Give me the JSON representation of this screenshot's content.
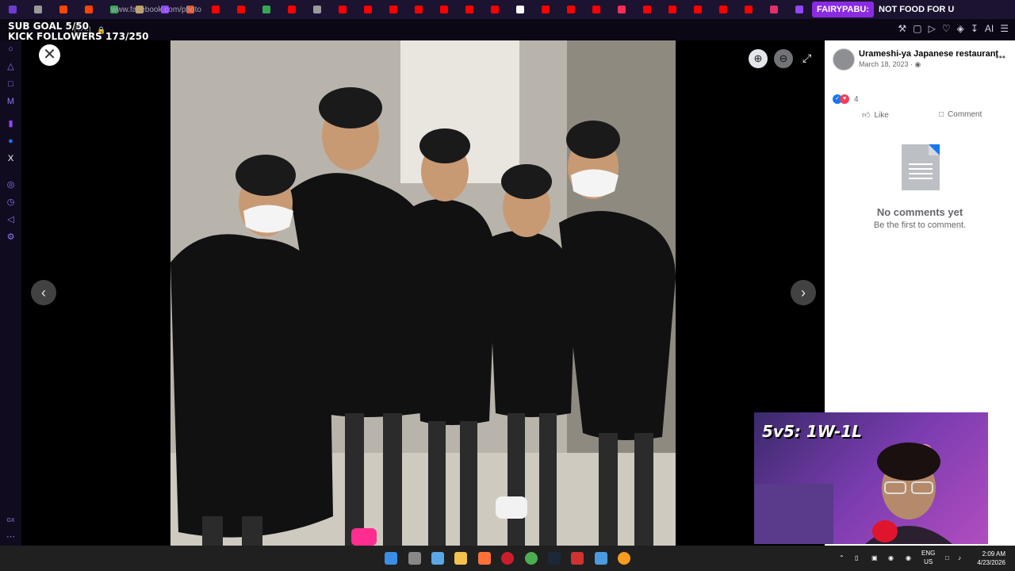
{
  "browser": {
    "tabs": [
      {
        "icon": "opera-icon",
        "color": "#6e3bd1"
      },
      {
        "icon": "gamepad-icon",
        "color": "#9a9a9a"
      },
      {
        "icon": "reddit-icon",
        "color": "#ff4500"
      },
      {
        "icon": "reddit-icon",
        "color": "#ff4500"
      },
      {
        "icon": "google-icon",
        "color": "#34a853"
      },
      {
        "icon": "game-icon",
        "color": "#c0a060"
      },
      {
        "icon": "twitch-icon",
        "color": "#9146ff"
      },
      {
        "icon": "web-icon",
        "color": "#e8552a"
      },
      {
        "icon": "youtube-icon",
        "color": "#ff0000"
      },
      {
        "icon": "youtube-icon",
        "color": "#ff0000"
      },
      {
        "icon": "google-icon",
        "color": "#34a853"
      },
      {
        "icon": "youtube-icon",
        "color": "#ff0000"
      },
      {
        "icon": "github-icon",
        "color": "#9a9a9a"
      },
      {
        "icon": "youtube-icon",
        "color": "#ff0000"
      },
      {
        "icon": "youtube-icon",
        "color": "#ff0000"
      },
      {
        "icon": "youtube-icon",
        "color": "#ff0000"
      },
      {
        "icon": "youtube-icon",
        "color": "#ff0000"
      },
      {
        "icon": "youtube-icon",
        "color": "#ff0000"
      },
      {
        "icon": "youtube-icon",
        "color": "#ff0000"
      },
      {
        "icon": "youtube-icon",
        "color": "#ff0000"
      },
      {
        "icon": "circle-icon",
        "color": "#ffffff"
      },
      {
        "icon": "youtube-icon",
        "color": "#ff0000"
      },
      {
        "icon": "youtube-icon",
        "color": "#ff0000"
      },
      {
        "icon": "youtube-icon",
        "color": "#ff0000"
      },
      {
        "icon": "record-icon",
        "color": "#ff2d55"
      },
      {
        "icon": "youtube-icon",
        "color": "#ff0000"
      },
      {
        "icon": "youtube-icon",
        "color": "#ff0000"
      },
      {
        "icon": "youtube-icon",
        "color": "#ff0000"
      },
      {
        "icon": "youtube-icon",
        "color": "#ff0000"
      },
      {
        "icon": "youtube-icon",
        "color": "#ff0000"
      },
      {
        "icon": "instagram-icon",
        "color": "#e1306c"
      },
      {
        "icon": "twitch-icon",
        "color": "#9146ff"
      }
    ],
    "text_tabs": [
      "FAIRYPABU:",
      "NOT FOOD FOR U"
    ],
    "url": "www.facebook.com/photo",
    "vpn": "VPN"
  },
  "stream_overlay": {
    "line1": "SUB GOAL 5/50",
    "line2": "KICK FOLLOWERS 173/250"
  },
  "post": {
    "page_name": "Urameshi-ya Japanese restaurant",
    "date": "March 18, 2023 · ",
    "reaction_count": "4",
    "like_label": "Like",
    "comment_label": "Comment",
    "no_comments_title": "No comments yet",
    "no_comments_sub": "Be the first to comment."
  },
  "webcam": {
    "label": "5v5: 1W-1L"
  },
  "system": {
    "lang": "ENG",
    "region": "US",
    "time": "2:09 AM",
    "date": "4/23/2026"
  }
}
